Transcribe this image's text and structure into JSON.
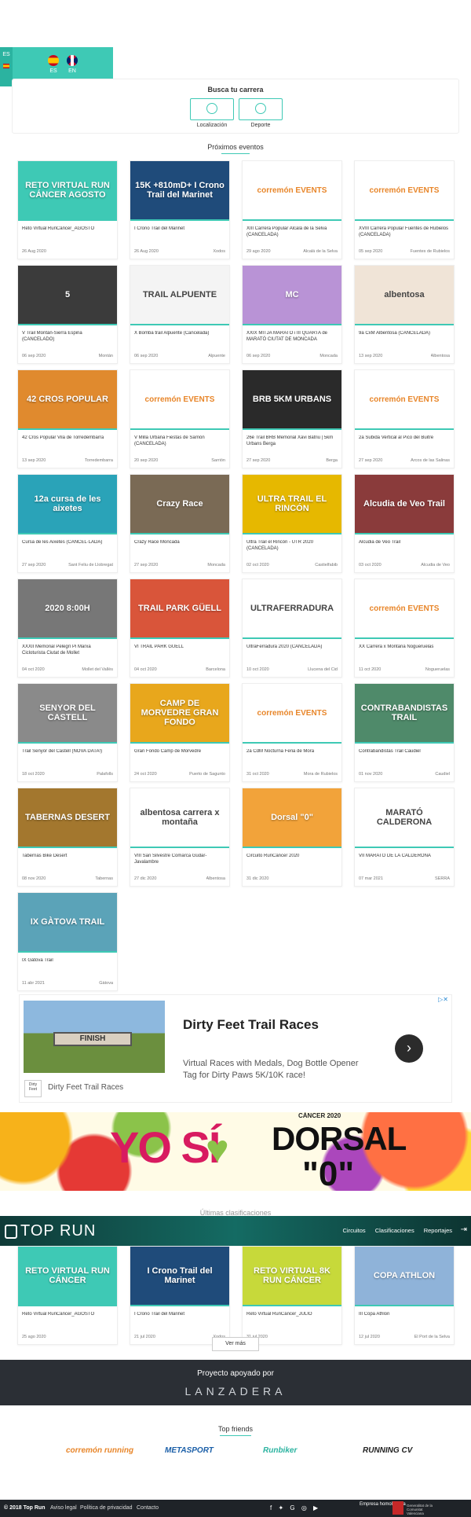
{
  "language": {
    "tab_label": "ES",
    "options": [
      {
        "code": "ES"
      },
      {
        "code": "EN"
      }
    ]
  },
  "search": {
    "title": "Busca tu carrera",
    "filters": [
      {
        "label": "Localización"
      },
      {
        "label": "Deporte"
      }
    ]
  },
  "events_section": {
    "title": "Próximos eventos",
    "cards": [
      {
        "title": "Reto Virtual RunCáncer_AGOSTO",
        "date": "26 Aug 2020",
        "place": "",
        "thumb_text": "RETO VIRTUAL RUN CÁNCER AGOSTO",
        "thumb_color": "#3ec9b5"
      },
      {
        "title": "I Crono Trail del Marinet",
        "date": "26 Aug 2020",
        "place": "Xodos",
        "thumb_text": "15K +810mD+ I Crono Trail del Marinet",
        "thumb_color": "#1f4b7a"
      },
      {
        "title": "XIII Carrera Popular Alcalá de la Selva (CANCELADA)",
        "date": "29 ago 2020",
        "place": "Alcalá de la Selva",
        "thumb_text": "corremón EVENTS",
        "thumb_color": "#ffffff"
      },
      {
        "title": "XVIII Carrera Popular Fuentes de Rubielos (CANCELADA)",
        "date": "05 sep 2020",
        "place": "Fuentes de Rubielos",
        "thumb_text": "corremón EVENTS",
        "thumb_color": "#ffffff"
      },
      {
        "title": "V Trail Montán-Sierra Espina (CANCELADO)",
        "date": "06 sep 2020",
        "place": "Montán",
        "thumb_text": "5",
        "thumb_color": "#3b3b3b"
      },
      {
        "title": "X Bomba trail Alpuente (Cancelada)",
        "date": "06 sep 2020",
        "place": "Alpuente",
        "thumb_text": "TRAIL ALPUENTE",
        "thumb_color": "#f4f4f4"
      },
      {
        "title": "XXIX MITJA MARATÓ i III QUARTA de MARATÓ CIUTAT DE MONCADA",
        "date": "06 sep 2020",
        "place": "Moncada",
        "thumb_text": "MC",
        "thumb_color": "#b993d6"
      },
      {
        "title": "9a CxM Albentosa (CANCELADA)",
        "date": "13 sep 2020",
        "place": "Albentosa",
        "thumb_text": "albentosa",
        "thumb_color": "#f0e4d7"
      },
      {
        "title": "42 Cros Popular Vila de Torredembarra",
        "date": "13 sep 2020",
        "place": "Torredembarra",
        "thumb_text": "42 CROS POPULAR",
        "thumb_color": "#e08a2e"
      },
      {
        "title": "V Milla Urbana Fiestas de Sarrión (CANCELADA)",
        "date": "20 sep 2020",
        "place": "Sarrión",
        "thumb_text": "corremón EVENTS",
        "thumb_color": "#ffffff"
      },
      {
        "title": "26è Trail BRB Memorial Xavi Batriu | 5km Urbans Berga",
        "date": "27 sep 2020",
        "place": "Berga",
        "thumb_text": "BRB 5KM URBANS",
        "thumb_color": "#2a2a2a"
      },
      {
        "title": "2a Subida Vertical al Pico del Buitre",
        "date": "27 sep 2020",
        "place": "Arcos de las Salinas",
        "thumb_text": "corremón EVENTS",
        "thumb_color": "#ffffff"
      },
      {
        "title": "Cursa de les Aixetes (CANCEL·LADA)",
        "date": "27 sep 2020",
        "place": "Sant Feliu de Llobregat",
        "thumb_text": "12a cursa de les aixetes",
        "thumb_color": "#2aa3b8"
      },
      {
        "title": "Crazy Race Moncada",
        "date": "27 sep 2020",
        "place": "Moncada",
        "thumb_text": "Crazy Race",
        "thumb_color": "#7a6a55"
      },
      {
        "title": "Ultra Trail el Rincón - UTR 2020 (CANCELADA)",
        "date": "02 oct 2020",
        "place": "Castielfabib",
        "thumb_text": "ULTRA TRAIL EL RINCÓN",
        "thumb_color": "#e6b800"
      },
      {
        "title": "Alcudia de Veo Trail",
        "date": "03 oct 2020",
        "place": "Alcudia de Veo",
        "thumb_text": "Alcudia de Veo Trail",
        "thumb_color": "#8a3b3b"
      },
      {
        "title": "XXXII Memorial Pelegrí Pi Marxa Cicloturista Ciutat de Mollet",
        "date": "04 oct 2020",
        "place": "Mollet del Vallès",
        "thumb_text": "2020 8:00H",
        "thumb_color": "#777777"
      },
      {
        "title": "VI TRAIL PARK GÜELL",
        "date": "04 oct 2020",
        "place": "Barcelona",
        "thumb_text": "TRAIL PARK GÜELL",
        "thumb_color": "#d9553a"
      },
      {
        "title": "UltraFerradura 2020 (CANCELADA)",
        "date": "10 oct 2020",
        "place": "Llucena del Cid",
        "thumb_text": "ULTRAFERRADURA",
        "thumb_color": "#ffffff"
      },
      {
        "title": "XX Carrera x Montaña Nogueruelas",
        "date": "11 oct 2020",
        "place": "Nogueruelas",
        "thumb_text": "corremón EVENTS",
        "thumb_color": "#ffffff"
      },
      {
        "title": "Trail Senyor del Castell (NOVA DATA!)",
        "date": "18 oct 2020",
        "place": "Palafolls",
        "thumb_text": "SENYOR DEL CASTELL",
        "thumb_color": "#8a8a8a"
      },
      {
        "title": "Gran Fondo Camp de Morvedre",
        "date": "24 oct 2020",
        "place": "Puerto de Sagunto",
        "thumb_text": "CAMP DE MORVEDRE GRAN FONDO",
        "thumb_color": "#e8a71c"
      },
      {
        "title": "2a CdM Nocturna Feria de Mora",
        "date": "31 oct 2020",
        "place": "Mora de Rubielos",
        "thumb_text": "corremón EVENTS",
        "thumb_color": "#ffffff"
      },
      {
        "title": "Contrabandistas Trail Caudiel",
        "date": "01 nov 2020",
        "place": "Caudiel",
        "thumb_text": "CONTRABANDISTAS TRAIL",
        "thumb_color": "#4f8a6a"
      },
      {
        "title": "Tabernas Bike Desert",
        "date": "08 nov 2020",
        "place": "Tabernas",
        "thumb_text": "TABERNAS DESERT",
        "thumb_color": "#a3772e"
      },
      {
        "title": "VIII San Silvestre Comarca Gúdar-Javalambre",
        "date": "27 dic 2020",
        "place": "Albentosa",
        "thumb_text": "albentosa carrera x montaña",
        "thumb_color": "#ffffff"
      },
      {
        "title": "Circuito RunCáncer 2020",
        "date": "31 dic 2020",
        "place": "",
        "thumb_text": "Dorsal \"0\"",
        "thumb_color": "#f2a33a"
      },
      {
        "title": "VII MARATÓ DE LA CALDERONA",
        "date": "07 mar 2021",
        "place": "SERRA",
        "thumb_text": "MARATÓ CALDERONA",
        "thumb_color": "#ffffff"
      },
      {
        "title": "IX Gàtova Trail",
        "date": "11 abr 2021",
        "place": "Gàtova",
        "thumb_text": "IX GÀTOVA TRAIL",
        "thumb_color": "#5ba3b8"
      }
    ]
  },
  "ad": {
    "finish_text": "FINISH",
    "title": "Dirty Feet Trail Races",
    "description": "Virtual Races with Medals, Dog Bottle Opener Tag for Dirty Paws 5K/10K race!",
    "brand": "Dirty Feet Trail Races",
    "logo_text": "Dirty Feet",
    "arrow": "›",
    "choice": "▷✕"
  },
  "banner": {
    "yo": "YO SÍ",
    "cancer": "CÁNCER 2020",
    "dorsal": "DORSAL",
    "zero": "\"0\""
  },
  "results_section": {
    "title": "Últimas clasificaciones",
    "cards": [
      {
        "title": "Reto Virtual RunCáncer_AGOSTO",
        "date": "25 ago 2020",
        "place": "",
        "thumb_text": "RETO VIRTUAL RUN CÁNCER",
        "thumb_color": "#3ec9b5"
      },
      {
        "title": "I Crono Trail del Marinet",
        "date": "21 jul 2020",
        "place": "Xodos",
        "thumb_text": "I Crono Trail del Marinet",
        "thumb_color": "#1f4b7a"
      },
      {
        "title": "Reto Virtual RunCáncer_JULIO",
        "date": "31 jul 2020",
        "place": "",
        "thumb_text": "RETO VIRTUAL 8K RUN CÁNCER",
        "thumb_color": "#c7d93a"
      },
      {
        "title": "III Copa Athlon",
        "date": "12 jul 2020",
        "place": "El Port de la Selva",
        "thumb_text": "COPA ATHLON",
        "thumb_color": "#8fb3d9"
      }
    ],
    "more_label": "Ver más"
  },
  "nav": {
    "logo_text": "TOP RUN",
    "links": [
      "Circuitos",
      "Clasificaciones",
      "Reportajes"
    ],
    "login_icon": "⇥"
  },
  "support": {
    "title": "Proyecto apoyado por",
    "logo": "LANZADERA"
  },
  "friends": {
    "title": "Top friends",
    "items": [
      "corremón running",
      "METASPORT",
      "Runbiker",
      "RUNNING CV"
    ],
    "colors": [
      "#e8862a",
      "#1b5fa8",
      "#2bb3a0",
      "#222222"
    ]
  },
  "footer": {
    "copyright": "© 2018 Top Run",
    "links": [
      "Aviso legal",
      "Política de privacidad",
      "Contacto"
    ],
    "social": "f ✦ G ◎ ▶",
    "company": "Empresa homologada",
    "gov": "Generalitat de la Comunitat Valenciana"
  }
}
